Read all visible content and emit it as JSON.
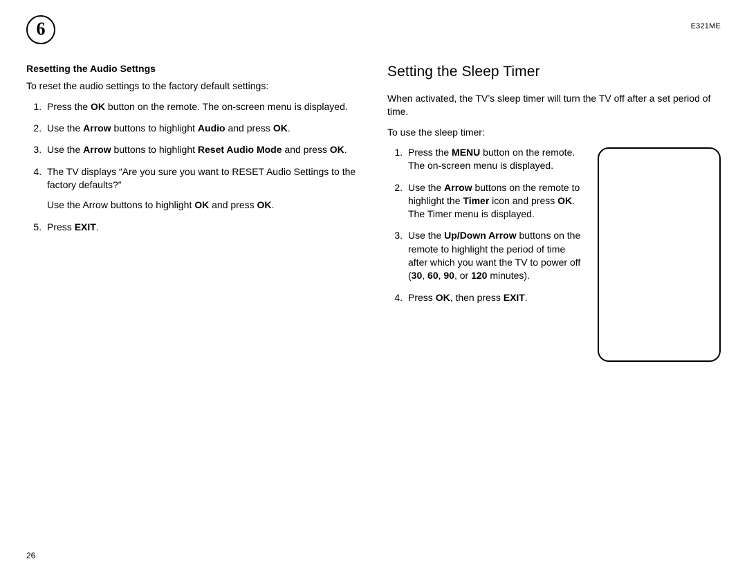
{
  "header": {
    "chapter_number": "6",
    "model": "E321ME"
  },
  "left": {
    "subhead": "Resetting the Audio Settngs",
    "intro": "To reset the audio settings to the factory default settings:",
    "steps": {
      "s1_a": "Press the ",
      "s1_b": "OK",
      "s1_c": " button on the remote. The on-screen menu is displayed.",
      "s2_a": "Use the ",
      "s2_b": "Arrow",
      "s2_c": " buttons to highlight ",
      "s2_d": "Audio",
      "s2_e": " and press ",
      "s2_f": "OK",
      "s2_g": ".",
      "s3_a": "Use the ",
      "s3_b": "Arrow",
      "s3_c": " buttons to highlight ",
      "s3_d": "Reset Audio Mode",
      "s3_e": " and press ",
      "s3_f": "OK",
      "s3_g": ".",
      "s4": "The TV displays “Are you sure you want to RESET Audio Settings to the factory defaults?”",
      "s4_sub_a": "Use the Arrow buttons to highlight ",
      "s4_sub_b": "OK",
      "s4_sub_c": " and press ",
      "s4_sub_d": "OK",
      "s4_sub_e": ".",
      "s5_a": "Press ",
      "s5_b": "EXIT",
      "s5_c": "."
    }
  },
  "right": {
    "title": "Setting the Sleep Timer",
    "intro": "When activated, the TV’s sleep timer will turn the TV off after a set period of time.",
    "lead": "To use the sleep timer:",
    "steps": {
      "s1_a": "Press the ",
      "s1_b": "MENU",
      "s1_c": " button on the remote. The on-screen menu is displayed.",
      "s2_a": "Use the ",
      "s2_b": "Arrow",
      "s2_c": " buttons on the remote to highlight the ",
      "s2_d": "Timer",
      "s2_e": " icon and press ",
      "s2_f": "OK",
      "s2_g": ". The Timer menu is displayed.",
      "s3_a": "Use the ",
      "s3_b": "Up/Down Arrow",
      "s3_c": " buttons on the remote to highlight the period of time after which you want the TV to power off (",
      "s3_d": "30",
      "s3_e": ", ",
      "s3_f": "60",
      "s3_g": ", ",
      "s3_h": "90",
      "s3_i": ", or ",
      "s3_j": "120",
      "s3_k": " minutes).",
      "s4_a": "Press ",
      "s4_b": "OK",
      "s4_c": ", then press ",
      "s4_d": "EXIT",
      "s4_e": "."
    }
  },
  "footer": {
    "page_number": "26"
  }
}
